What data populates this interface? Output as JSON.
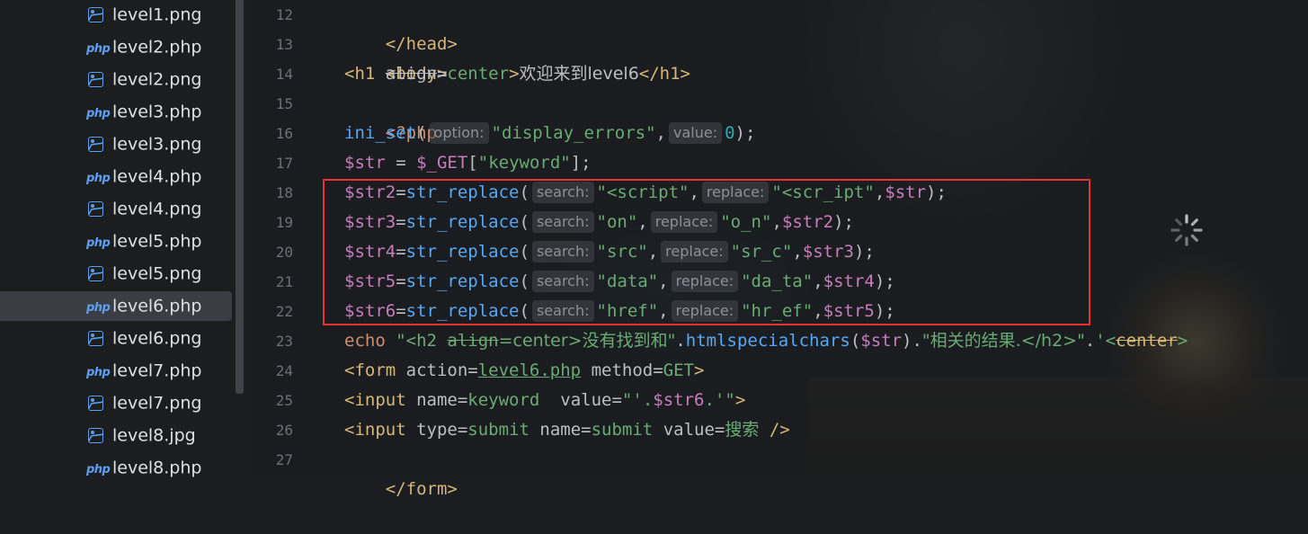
{
  "sidebar": {
    "files": [
      {
        "name": "level1.png",
        "type": "image"
      },
      {
        "name": "level2.php",
        "type": "php"
      },
      {
        "name": "level2.png",
        "type": "image"
      },
      {
        "name": "level3.php",
        "type": "php"
      },
      {
        "name": "level3.png",
        "type": "image"
      },
      {
        "name": "level4.php",
        "type": "php"
      },
      {
        "name": "level4.png",
        "type": "image"
      },
      {
        "name": "level5.php",
        "type": "php"
      },
      {
        "name": "level5.png",
        "type": "image"
      },
      {
        "name": "level6.php",
        "type": "php",
        "selected": true
      },
      {
        "name": "level6.png",
        "type": "image"
      },
      {
        "name": "level7.php",
        "type": "php"
      },
      {
        "name": "level7.png",
        "type": "image"
      },
      {
        "name": "level8.jpg",
        "type": "image"
      },
      {
        "name": "level8.php",
        "type": "php"
      }
    ],
    "php_icon_text": "php"
  },
  "editor": {
    "line_numbers": [
      "12",
      "13",
      "14",
      "15",
      "16",
      "17",
      "18",
      "19",
      "20",
      "21",
      "22",
      "23",
      "24",
      "25",
      "26",
      "27"
    ],
    "lines": {
      "l12": {
        "t1": "</head>"
      },
      "l13": {
        "t1": "<body>"
      },
      "l14": {
        "t1": "<h1 ",
        "a1": "align",
        "eq": "=",
        "v1": "center",
        "t2": ">",
        "txt": "欢迎来到level6",
        "t3": "</h1>"
      },
      "l15": {
        "t1": "<?php"
      },
      "l16": {
        "fn": "ini_set",
        "p1": "(",
        "h1": "option:",
        "s1": "\"display_errors\"",
        "c1": ",",
        "h2": "value:",
        "n1": "0",
        "p2": ");"
      },
      "l17": {
        "v1": "$str",
        "o1": " = ",
        "v2": "$_GET",
        "p1": "[",
        "s1": "\"keyword\"",
        "p2": "];"
      },
      "l18": {
        "v1": "$str2",
        "o1": "=",
        "fn": "str_replace",
        "p1": "(",
        "h1": "search:",
        "s1": "\"<script\"",
        "c1": ",",
        "h2": "replace:",
        "s2": "\"<scr_ipt\"",
        "c2": ",",
        "v2": "$str",
        "p2": ");"
      },
      "l19": {
        "v1": "$str3",
        "o1": "=",
        "fn": "str_replace",
        "p1": "(",
        "h1": "search:",
        "s1": "\"on\"",
        "c1": ",",
        "h2": "replace:",
        "s2": "\"o_n\"",
        "c2": ",",
        "v2": "$str2",
        "p2": ");"
      },
      "l20": {
        "v1": "$str4",
        "o1": "=",
        "fn": "str_replace",
        "p1": "(",
        "h1": "search:",
        "s1": "\"src\"",
        "c1": ",",
        "h2": "replace:",
        "s2": "\"sr_c\"",
        "c2": ",",
        "v2": "$str3",
        "p2": ");"
      },
      "l21": {
        "v1": "$str5",
        "o1": "=",
        "fn": "str_replace",
        "p1": "(",
        "h1": "search:",
        "s1": "\"data\"",
        "c1": ",",
        "h2": "replace:",
        "s2": "\"da_ta\"",
        "c2": ",",
        "v2": "$str4",
        "p2": ");"
      },
      "l22": {
        "v1": "$str6",
        "o1": "=",
        "fn": "str_replace",
        "p1": "(",
        "h1": "search:",
        "s1": "\"href\"",
        "c1": ",",
        "h2": "replace:",
        "s2": "\"hr_ef\"",
        "c2": ",",
        "v2": "$str5",
        "p2": ");"
      },
      "l23": {
        "kw": "echo ",
        "s1": "\"<h2 ",
        "a1": "align",
        "s2": "=center>没有找到和\"",
        "p1": ".",
        "fn": "htmlspecialchars",
        "p2": "(",
        "v1": "$str",
        "p3": ").",
        "s3": "\"相关的结果.</h2>\"",
        "p4": ".",
        "s4": "'<",
        "a2": "center",
        "s5": ">"
      },
      "l24": {
        "t1": "<form ",
        "a1": "action",
        "eq1": "=",
        "lnk": "level6.php",
        "sp": " ",
        "a2": "method",
        "eq2": "=",
        "v2": "GET",
        "t2": ">"
      },
      "l25": {
        "t1": "<input ",
        "a1": "name",
        "eq1": "=",
        "v1": "keyword",
        "sp": "  ",
        "a2": "value",
        "eq2": "=",
        "q1": "\"",
        "s1": "'.",
        "var": "$str6",
        "s2": ".'",
        "q2": "\"",
        "t2": ">"
      },
      "l26": {
        "t1": "<input ",
        "a1": "type",
        "eq1": "=",
        "v1": "submit",
        "sp1": " ",
        "a2": "name",
        "eq2": "=",
        "v2": "submit",
        "sp2": " ",
        "a3": "value",
        "eq3": "=",
        "v3": "搜索",
        "t2": " />"
      },
      "l27": {
        "t1": "</form>"
      }
    }
  },
  "colors": {
    "tag": "#d5b778",
    "variable": "#c77dbb",
    "function": "#56a8f5",
    "string": "#6aab73",
    "number": "#2aacb8",
    "keyword": "#cf8e6d",
    "highlight_border": "#e5332f",
    "file_icon": "#5e9ff2"
  }
}
